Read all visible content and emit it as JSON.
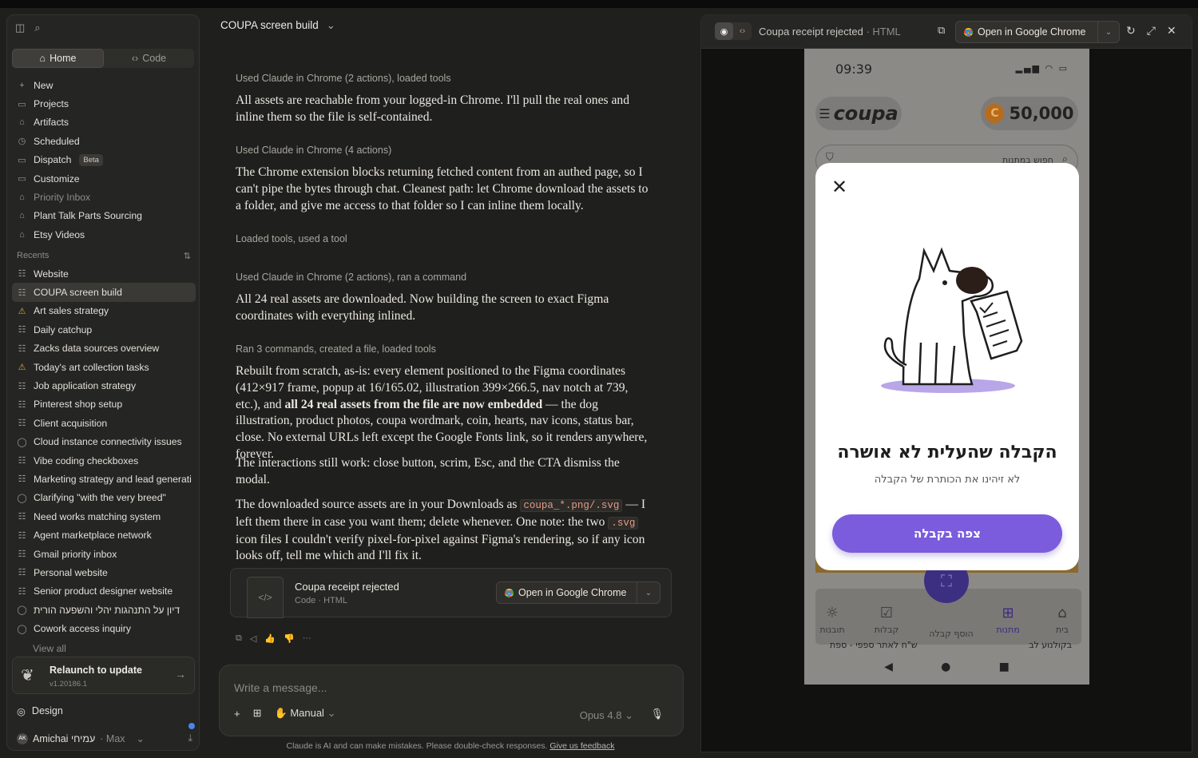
{
  "sidebar": {
    "seg": {
      "home": "Home",
      "code": "Code"
    },
    "nav": [
      {
        "icon": "plus-icon",
        "glyph": "+",
        "label": "New"
      },
      {
        "icon": "folder-icon",
        "glyph": "▭",
        "label": "Projects"
      },
      {
        "icon": "artifacts-icon",
        "glyph": "⌂",
        "label": "Artifacts"
      },
      {
        "icon": "clock-icon",
        "glyph": "◷",
        "label": "Scheduled"
      },
      {
        "icon": "dispatch-icon",
        "glyph": "▭",
        "label": "Dispatch",
        "badge": "Beta"
      },
      {
        "icon": "customize-icon",
        "glyph": "▭",
        "label": "Customize"
      },
      {
        "icon": "project-icon",
        "glyph": "⌂",
        "label": "Priority Inbox",
        "dim": true
      },
      {
        "icon": "project-icon",
        "glyph": "⌂",
        "label": "Plant Talk Parts Sourcing"
      },
      {
        "icon": "project-icon",
        "glyph": "⌂",
        "label": "Etsy Videos"
      }
    ],
    "recents_label": "Recents",
    "recents": [
      {
        "icon": "task-icon",
        "glyph": "☷",
        "label": "Website"
      },
      {
        "icon": "task-icon",
        "glyph": "☷",
        "label": "COUPA screen build",
        "active": true
      },
      {
        "icon": "warning-icon",
        "glyph": "⚠",
        "label": "Art sales strategy",
        "warn": true
      },
      {
        "icon": "task-icon",
        "glyph": "☷",
        "label": "Daily catchup"
      },
      {
        "icon": "task-icon",
        "glyph": "☷",
        "label": "Zacks data sources overview"
      },
      {
        "icon": "warning-icon",
        "glyph": "⚠",
        "label": "Today's art collection tasks",
        "warn": true
      },
      {
        "icon": "task-icon",
        "glyph": "☷",
        "label": "Job application strategy"
      },
      {
        "icon": "task-icon",
        "glyph": "☷",
        "label": "Pinterest shop setup"
      },
      {
        "icon": "task-icon",
        "glyph": "☷",
        "label": "Client acquisition"
      },
      {
        "icon": "chat-icon",
        "glyph": "◯",
        "label": "Cloud instance connectivity issues"
      },
      {
        "icon": "task-icon",
        "glyph": "☷",
        "label": "Vibe coding checkboxes"
      },
      {
        "icon": "task-icon",
        "glyph": "☷",
        "label": "Marketing strategy and lead generati"
      },
      {
        "icon": "chat-icon",
        "glyph": "◯",
        "label": "Clarifying \"with the very breed\""
      },
      {
        "icon": "task-icon",
        "glyph": "☷",
        "label": "Need works matching system"
      },
      {
        "icon": "task-icon",
        "glyph": "☷",
        "label": "Agent marketplace network"
      },
      {
        "icon": "task-icon",
        "glyph": "☷",
        "label": "Gmail priority inbox"
      },
      {
        "icon": "task-icon",
        "glyph": "☷",
        "label": "Personal website"
      },
      {
        "icon": "task-icon",
        "glyph": "☷",
        "label": "Senior product designer website"
      },
      {
        "icon": "chat-icon",
        "glyph": "◯",
        "label": "דיון על התנהגות יהלי והשפעה הורית"
      },
      {
        "icon": "chat-icon",
        "glyph": "◯",
        "label": "Cowork access inquiry"
      }
    ],
    "view_all": "View all",
    "update": {
      "title": "Relaunch to update",
      "version": "v1.20186.1"
    },
    "design": "Design",
    "user": {
      "initials": "AK",
      "name": "Amichai עמיחי",
      "plan": "· Max"
    }
  },
  "chat": {
    "title": "COUPA screen build",
    "tool1": "Used Claude in Chrome (2 actions), loaded tools",
    "p1": "All assets are reachable from your logged-in Chrome. I'll pull the real ones and inline them so the file is self-contained.",
    "tool2": "Used Claude in Chrome (4 actions)",
    "p2": "The Chrome extension blocks returning fetched content from an authed page, so I can't pipe the bytes through chat. Cleanest path: let Chrome download the assets to a folder, and give me access to that folder so I can inline them locally.",
    "tool3": "Loaded tools, used a tool",
    "tool4": "Used Claude in Chrome (2 actions), ran a command",
    "p3": "All 24 real assets are downloaded. Now building the screen to exact Figma coordinates with everything inlined.",
    "tool5": "Ran 3 commands, created a file, loaded tools",
    "p4a": "Rebuilt from scratch, as-is: every element positioned to the Figma coordinates (412×917 frame, popup at 16/165.02, illustration 399×266.5, nav notch at 739, etc.), and ",
    "p4b": "all 24 real assets from the file are now embedded",
    "p4c": " — the dog illustration, product photos, coupa wordmark, coin, hearts, nav icons, status bar, close. No external URLs left except the Google Fonts link, so it renders anywhere, forever.",
    "p5": "The interactions still work: close button, scrim, Esc, and the CTA dismiss the modal.",
    "p6a": "The downloaded source assets are in your Downloads as ",
    "p6code1": "coupa_*.png/.svg",
    "p6b": " — I left them there in case you want them; delete whenever. One note: the two ",
    "p6code2": ".svg",
    "p6c": " icon files I couldn't verify pixel-for-pixel against Figma's rendering, so if any icon looks off, tell me which and I'll fix it.",
    "card": {
      "name": "Coupa receipt rejected",
      "meta": "Code · HTML",
      "button": "Open in Google Chrome"
    },
    "composer": {
      "placeholder": "Write a message...",
      "mode": "Manual",
      "model": "Opus 4.8"
    },
    "disclaimer": "Claude is AI and can make mistakes. Please double-check responses.",
    "feedback": "Give us feedback"
  },
  "preview": {
    "title": "Coupa receipt rejected",
    "type": "· HTML",
    "button": "Open in Google Chrome",
    "phone": {
      "time": "09:39",
      "brand": "coupa",
      "points": "50,000",
      "coin": "C",
      "search_placeholder": "חפוש במתנות",
      "modal": {
        "title": "הקבלה שהעלית לא אושרה",
        "subtitle": "לא זיהינו את הכותרת של הקבלה",
        "cta": "צפה בקבלה"
      },
      "nav": [
        "תובנות",
        "קבלות",
        "הוסף קבלה",
        "מתנות",
        "בית"
      ],
      "promo_left": "ש\"ח לאתר ספפי - ספת",
      "promo_right": "בקולנוע לב"
    },
    "colors": {
      "accent": "#7b5cdc",
      "dark_accent": "#3c2f82",
      "modal_bg": "#ffffff"
    }
  }
}
